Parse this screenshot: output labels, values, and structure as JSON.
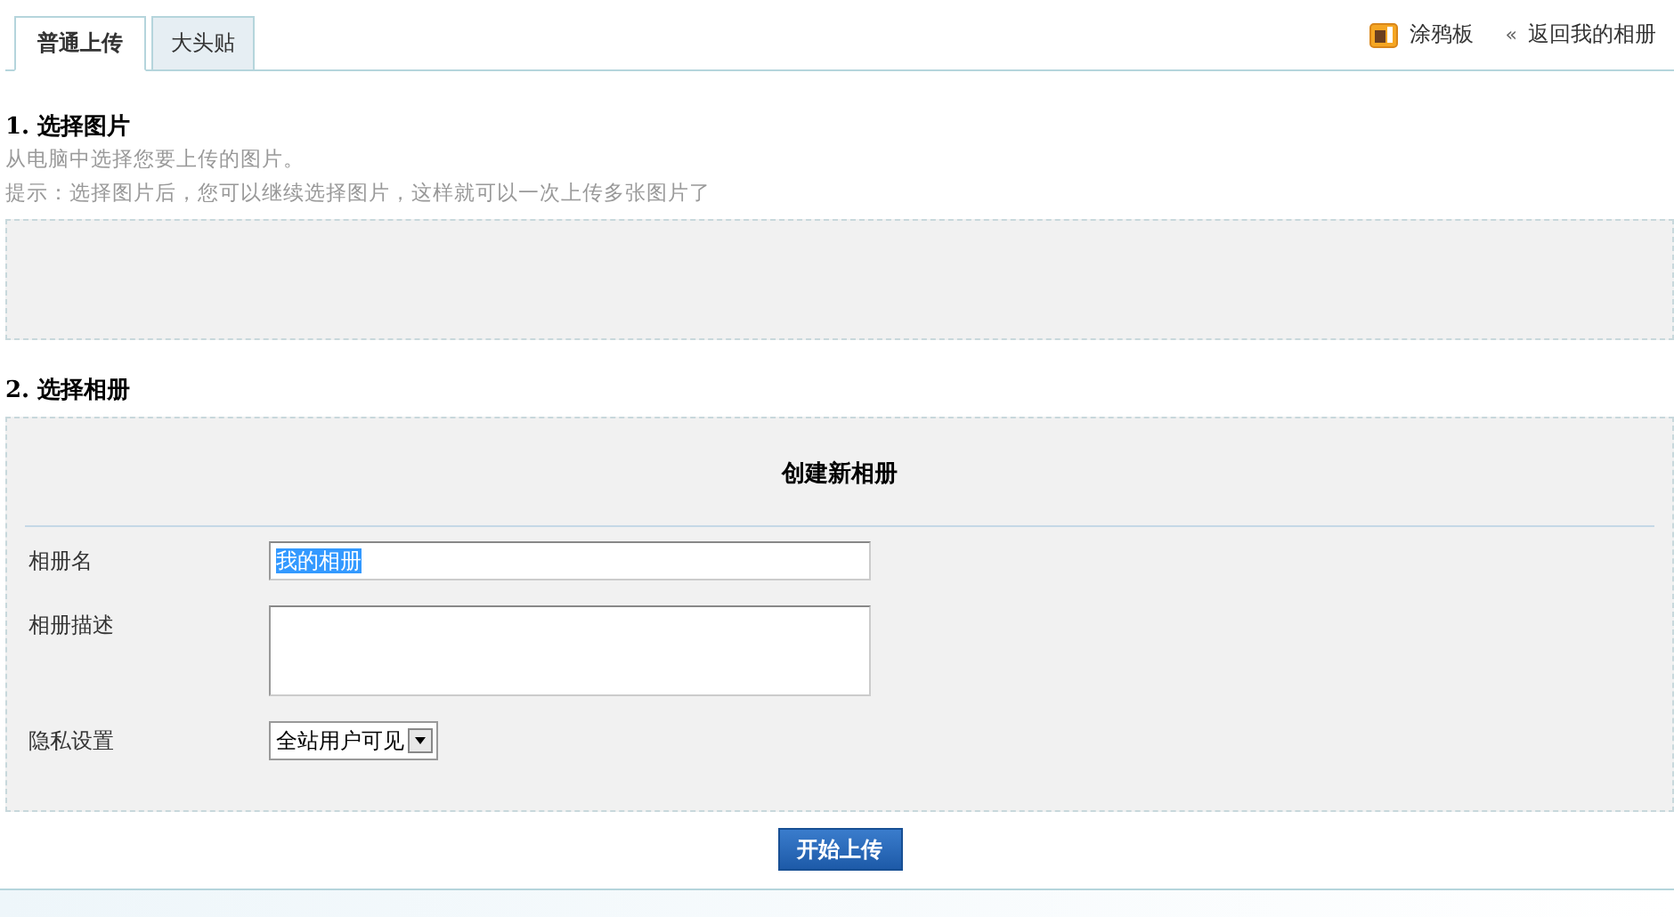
{
  "tabs": [
    {
      "label": "普通上传",
      "selected": true
    },
    {
      "label": "大头贴",
      "selected": false
    }
  ],
  "top_links": [
    {
      "kind": "graffiti",
      "label": "涂鸦板"
    },
    {
      "kind": "back",
      "label": "返回我的相册",
      "icon": "«"
    }
  ],
  "step1": {
    "title": "1. 选择图片",
    "description": "从电脑中选择您要上传的图片。",
    "hint": "提示：选择图片后，您可以继续选择图片，这样就可以一次上传多张图片了"
  },
  "step2": {
    "title": "2. 选择相册",
    "form_title": "创建新相册",
    "fields": [
      {
        "kind": "text",
        "label": "相册名",
        "value": "我的相册",
        "text_selected": true
      },
      {
        "kind": "textarea",
        "label": "相册描述"
      },
      {
        "kind": "select",
        "label": "隐私设置",
        "value": "全站用户可见"
      }
    ]
  },
  "submit": "开始上传"
}
